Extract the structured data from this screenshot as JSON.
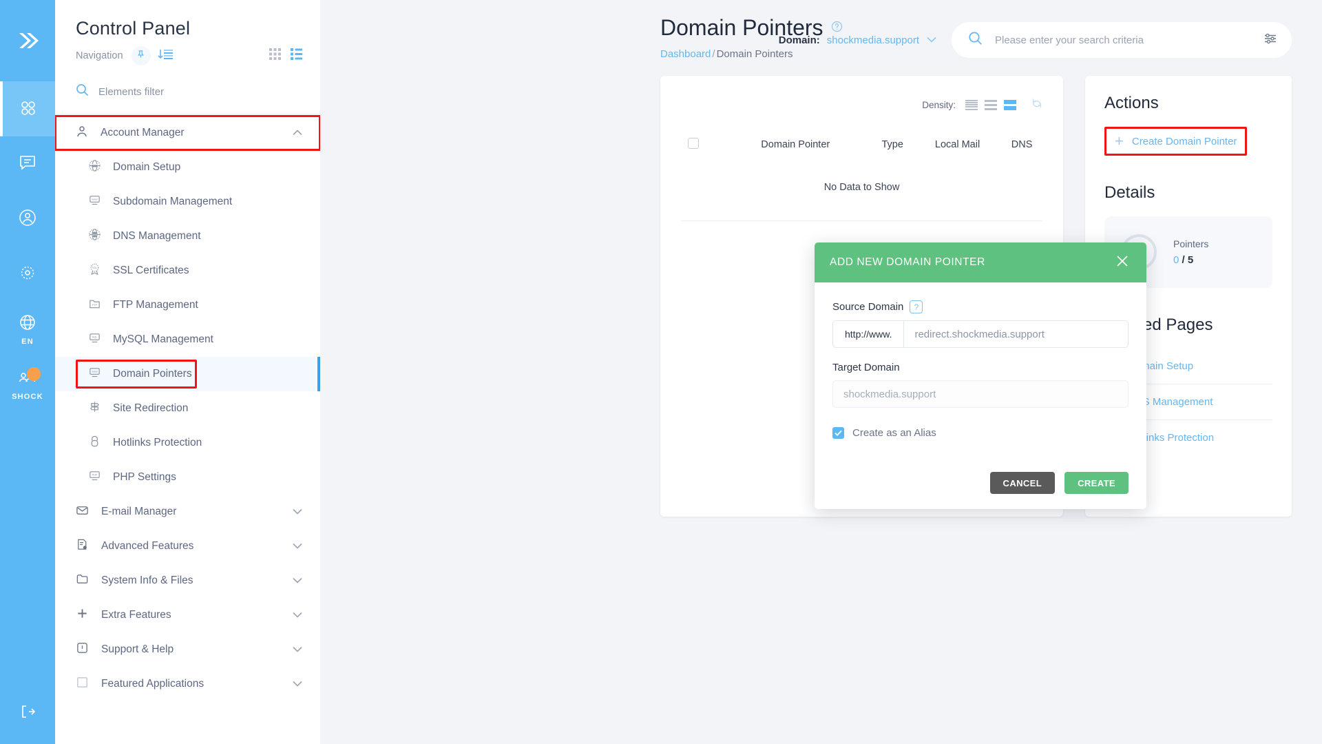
{
  "rail": {
    "items": [
      {
        "name": "logo",
        "icon": "chevrons-right-logo"
      },
      {
        "name": "dashboard",
        "icon": "grid-dots-icon",
        "label": "",
        "active": true
      },
      {
        "name": "messages",
        "icon": "chat-bubble-icon",
        "label": ""
      },
      {
        "name": "account",
        "icon": "user-circle-icon",
        "label": ""
      },
      {
        "name": "settings",
        "icon": "gear-icon",
        "label": ""
      },
      {
        "name": "language",
        "icon": "globe-icon",
        "label": "EN"
      },
      {
        "name": "user",
        "icon": "users-icon",
        "label": "SHOCK"
      }
    ],
    "logout_icon": "logout-icon"
  },
  "nav": {
    "title": "Control Panel",
    "subtitle": "Navigation",
    "filter_placeholder": "Elements filter",
    "group_label": "Account Manager",
    "items": [
      {
        "label": "Domain Setup",
        "icon": "www-globe-icon"
      },
      {
        "label": "Subdomain Management",
        "icon": "monitor-www-icon"
      },
      {
        "label": "DNS Management",
        "icon": "dns-globe-icon"
      },
      {
        "label": "SSL Certificates",
        "icon": "ssl-badge-icon"
      },
      {
        "label": "FTP Management",
        "icon": "ftp-folder-icon"
      },
      {
        "label": "MySQL Management",
        "icon": "sql-monitor-icon"
      },
      {
        "label": "Domain Pointers",
        "icon": "monitor-www-icon",
        "active": true
      },
      {
        "label": "Site Redirection",
        "icon": "signpost-icon"
      },
      {
        "label": "Hotlinks Protection",
        "icon": "lock-icon"
      },
      {
        "label": "PHP Settings",
        "icon": "php-monitor-icon"
      }
    ],
    "groups": [
      {
        "label": "E-mail Manager",
        "icon": "envelope-icon"
      },
      {
        "label": "Advanced Features",
        "icon": "document-gear-icon"
      },
      {
        "label": "System Info & Files",
        "icon": "folder-icon"
      },
      {
        "label": "Extra Features",
        "icon": "plus-icon"
      },
      {
        "label": "Support & Help",
        "icon": "exclamation-box-icon"
      },
      {
        "label": "Featured Applications",
        "icon": "square-icon"
      }
    ]
  },
  "header": {
    "page_title": "Domain Pointers",
    "help_icon": "question-circle-icon",
    "breadcrumb_root": "Dashboard",
    "breadcrumb_sep": "/",
    "breadcrumb_current": "Domain Pointers",
    "domain_label": "Domain:",
    "domain_value": "shockmedia.support",
    "search_placeholder": "Please enter your search criteria",
    "search_value": "",
    "search_icon": "search-icon",
    "filter_icon": "sliders-icon"
  },
  "table": {
    "density_label": "Density:",
    "refresh_icon": "refresh-icon",
    "columns": [
      "",
      "Domain Pointer",
      "Type",
      "Local Mail",
      "DNS"
    ],
    "rows": [],
    "empty_text": "No Data to Show"
  },
  "actions": {
    "title": "Actions",
    "create_label": "Create Domain Pointer",
    "plus_icon": "plus-icon"
  },
  "details": {
    "title": "Details",
    "percent": "0%",
    "metric_name": "Pointers",
    "used": "0",
    "separator": "/",
    "total": "5"
  },
  "related": {
    "title": "Related Pages",
    "items": [
      {
        "label": "Domain Setup",
        "icon": "www-globe-icon"
      },
      {
        "label": "DNS Management",
        "icon": "dns-globe-icon"
      },
      {
        "label": "Hotlinks Protection",
        "icon": "lock-icon"
      }
    ]
  },
  "modal": {
    "title": "ADD NEW DOMAIN POINTER",
    "close_icon": "close-icon",
    "source_label": "Source Domain",
    "help_icon": "question-icon",
    "prefix": "http://www.",
    "source_placeholder": "redirect.shockmedia.support",
    "source_value": "",
    "target_label": "Target Domain",
    "target_placeholder": "shockmedia.support",
    "target_value": "",
    "alias_label": "Create as an Alias",
    "alias_checked": true,
    "cancel_label": "CANCEL",
    "create_label": "CREATE"
  },
  "colors": {
    "rail": "#5bb8f5",
    "accent": "#67b6ef",
    "green": "#5ec17f",
    "highlight": "#f01414"
  }
}
